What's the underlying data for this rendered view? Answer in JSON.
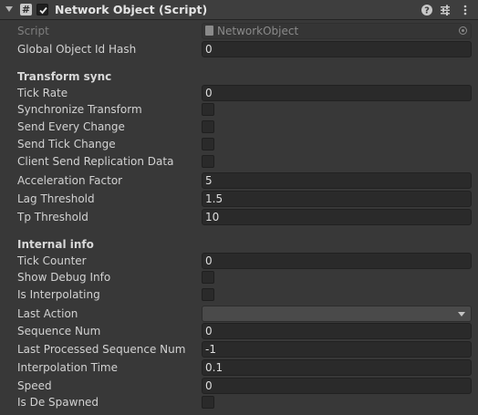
{
  "component": {
    "title": "Network Object (Script)",
    "script_icon_glyph": "#"
  },
  "script_field": {
    "label": "Script",
    "value": "NetworkObject"
  },
  "global_object_id_hash": {
    "label": "Global Object Id Hash",
    "value": "0"
  },
  "transform_sync": {
    "header": "Transform sync",
    "tick_rate": {
      "label": "Tick Rate",
      "value": "0"
    },
    "synchronize_transform": {
      "label": "Synchronize Transform",
      "checked": false
    },
    "send_every_change": {
      "label": "Send Every Change",
      "checked": false
    },
    "send_tick_change": {
      "label": "Send Tick Change",
      "checked": false
    },
    "client_send_replication_data": {
      "label": "Client Send Replication Data",
      "checked": false
    },
    "acceleration_factor": {
      "label": "Acceleration Factor",
      "value": "5"
    },
    "lag_threshold": {
      "label": "Lag Threshold",
      "value": "1.5"
    },
    "tp_threshold": {
      "label": "Tp Threshold",
      "value": "10"
    }
  },
  "internal_info": {
    "header": "Internal info",
    "tick_counter": {
      "label": "Tick Counter",
      "value": "0"
    },
    "show_debug_info": {
      "label": "Show Debug Info",
      "checked": false
    },
    "is_interpolating": {
      "label": "Is Interpolating",
      "checked": false
    },
    "last_action": {
      "label": "Last Action",
      "value": ""
    },
    "sequence_num": {
      "label": "Sequence Num",
      "value": "0"
    },
    "last_processed_sequence_num": {
      "label": "Last Processed Sequence Num",
      "value": "-1"
    },
    "interpolation_time": {
      "label": "Interpolation Time",
      "value": "0.1"
    },
    "speed": {
      "label": "Speed",
      "value": "0"
    },
    "is_de_spawned": {
      "label": "Is De Spawned",
      "checked": false
    }
  },
  "icons": {
    "foldout": "triangle-down",
    "script": "hash-script",
    "enabled": "checkmark",
    "help": "question-circle",
    "presets": "sliders",
    "menu": "vertical-dots",
    "object_picker": "circle-dot",
    "dropdown": "triangle-down"
  },
  "colors": {
    "background": "#383838",
    "header": "#3e3e3e",
    "field": "#2a2a2a",
    "text": "#d2d2d2"
  }
}
